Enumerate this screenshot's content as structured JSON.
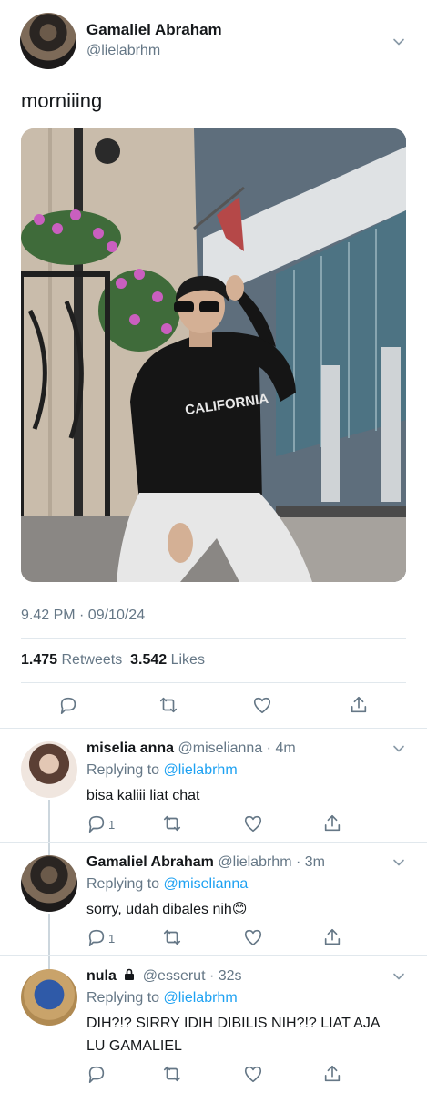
{
  "tweet": {
    "author_name": "Gamaliel Abraham",
    "author_handle": "@lielabrhm",
    "text": "morniiing",
    "timestamp": "9.42 PM · 09/10/24",
    "retweets_count": "1.475",
    "retweets_label": "Retweets",
    "likes_count": "3.542",
    "likes_label": "Likes",
    "photo_text": "CALIFORNIA"
  },
  "replies": [
    {
      "name": "miselia anna",
      "handle_time": "@miselianna · 4m",
      "replying_label": "Replying to",
      "replying_to": "@lielabrhm",
      "text": "bisa kaliii liat chat",
      "reply_count": "1"
    },
    {
      "name": "Gamaliel Abraham",
      "handle_time": "@lielabrhm · 3m",
      "replying_label": "Replying to",
      "replying_to": "@miselianna",
      "text": "sorry, udah dibales nih",
      "emoji": "😊",
      "reply_count": "1"
    },
    {
      "name": "nula",
      "handle_time": "@esserut · 32s",
      "replying_label": "Replying to",
      "replying_to": "@lielabrhm",
      "text_line1": "DIH?!? SIRRY IDIH DIBILIS NIH?!? LIAT AJA",
      "text_line2": "LU GAMALIEL"
    }
  ],
  "icons": [
    "chevron-down-icon",
    "reply-icon",
    "retweet-icon",
    "like-icon",
    "share-icon",
    "lock-icon"
  ],
  "colors": {
    "accent": "#1da1f2",
    "secondary_text": "#657786",
    "divider": "#e1e8ed"
  }
}
